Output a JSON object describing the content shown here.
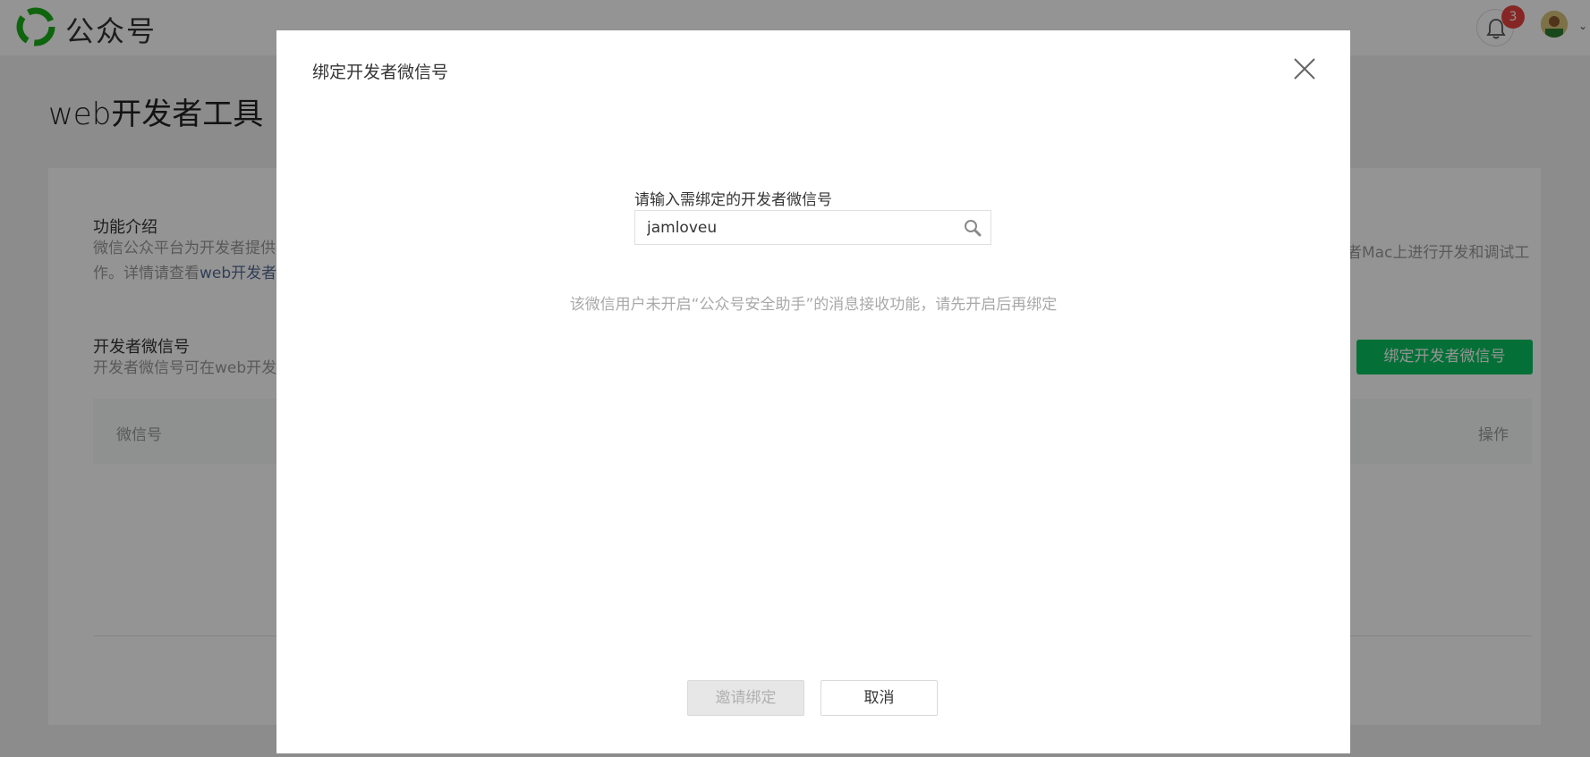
{
  "header": {
    "brand": "公众号",
    "notification_count": "3"
  },
  "page": {
    "title": "web开发者工具",
    "intro": {
      "title": "功能介绍",
      "desc_line1": "微信公众平台为开发者提供",
      "desc_right_line1": "者Mac上进行开发和调试工",
      "desc_line2_prefix": "作。详情请查看",
      "desc_line2_link": "web开发者"
    },
    "developer": {
      "title": "开发者微信号",
      "desc": "开发者微信号可在web开发",
      "bind_button": "绑定开发者微信号"
    },
    "table": {
      "col_wechat": "微信号",
      "col_action": "操作"
    }
  },
  "modal": {
    "title": "绑定开发者微信号",
    "field_label": "请输入需绑定的开发者微信号",
    "search_value": "jamloveu",
    "warning": "该微信用户未开启“公众号安全助手”的消息接收功能，请先开启后再绑定",
    "invite_button": "邀请绑定",
    "cancel_button": "取消"
  },
  "colors": {
    "brand_green": "#07c160",
    "badge_red": "#e64340",
    "link_blue": "#576b95"
  },
  "icons": [
    "wechat-logo-icon",
    "bell-icon",
    "close-icon",
    "search-icon",
    "chevron-down-icon"
  ]
}
